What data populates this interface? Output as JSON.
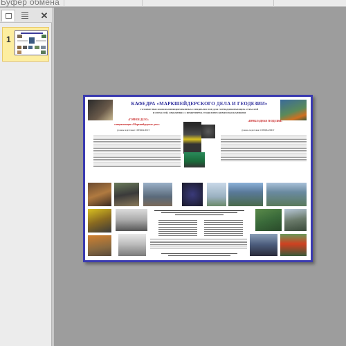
{
  "ribbon": {
    "label": "Буфер обмена"
  },
  "left_panel": {
    "tabs": [
      {
        "name": "slides",
        "icon": "slides-icon"
      },
      {
        "name": "outline",
        "icon": "outline-icon"
      }
    ],
    "close_label": "✕",
    "slides": [
      {
        "number": "1"
      }
    ]
  },
  "slide": {
    "title": "КАФЕДРА «МАРКШЕЙДЕРСКОГО ДЕЛА И ГЕОДЕЗИИ»",
    "subtitle_1": "ГОТОВИТ ВЫСОКОКВАЛИФИЦИРОВАННЫХ СПЕЦИАЛИСТОВ ДЛЯ ГОРНОДОБЫВАЮЩИХ ОТРАСЛЕЙ",
    "subtitle_2": "И ОТРАСЛЕЙ, СВЯЗАННЫХ С ИНЖЕНЕРНО-ГЕОДЕЗИЧЕСКИМИ ИЗЫСКАНИЯМИ",
    "left_block": {
      "heading_1": "«ГОРНОЕ ДЕЛО»",
      "heading_2": "специализация «Маркшейдерское дело»",
      "level": "уровень подготовки: СПЕЦИАЛИСТ"
    },
    "right_block": {
      "heading_1": "«ПРИКЛАДНАЯ ГЕОДЕЗИЯ»",
      "level": "уровень подготовки: СПЕЦИАЛИСТ"
    }
  },
  "colors": {
    "slide_border": "#3a3ab0",
    "title": "#2a2a9a",
    "heading_red": "#c62020",
    "thumb_selected": "#fdeea0"
  }
}
